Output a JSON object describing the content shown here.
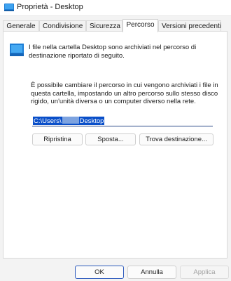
{
  "window": {
    "title": "Proprietà - Desktop",
    "icon": "desktop-folder-icon"
  },
  "tabs": [
    {
      "label": "Generale",
      "active": false
    },
    {
      "label": "Condivisione",
      "active": false
    },
    {
      "label": "Sicurezza",
      "active": false
    },
    {
      "label": "Percorso",
      "active": true
    },
    {
      "label": "Versioni precedenti",
      "active": false
    }
  ],
  "location": {
    "icon": "folder-icon",
    "intro_text": "I file nella cartella Desktop sono archiviati nel percorso di destinazione riportato di seguito.",
    "description_text": "È possibile cambiare il percorso in cui vengono archiviati i file in questa cartella, impostando un altro percorso sullo stesso disco rigido, un'unità diversa o un computer diverso nella rete.",
    "path_prefix": "C:\\Users\\",
    "path_suffix": "Desktop",
    "restore_label": "Ripristina",
    "move_label": "Sposta...",
    "find_target_label": "Trova destinazione..."
  },
  "footer": {
    "ok_label": "OK",
    "cancel_label": "Annulla",
    "apply_label": "Applica"
  },
  "colors": {
    "accent": "#0a4fc9",
    "folder_blue": "#1e7fd6"
  }
}
